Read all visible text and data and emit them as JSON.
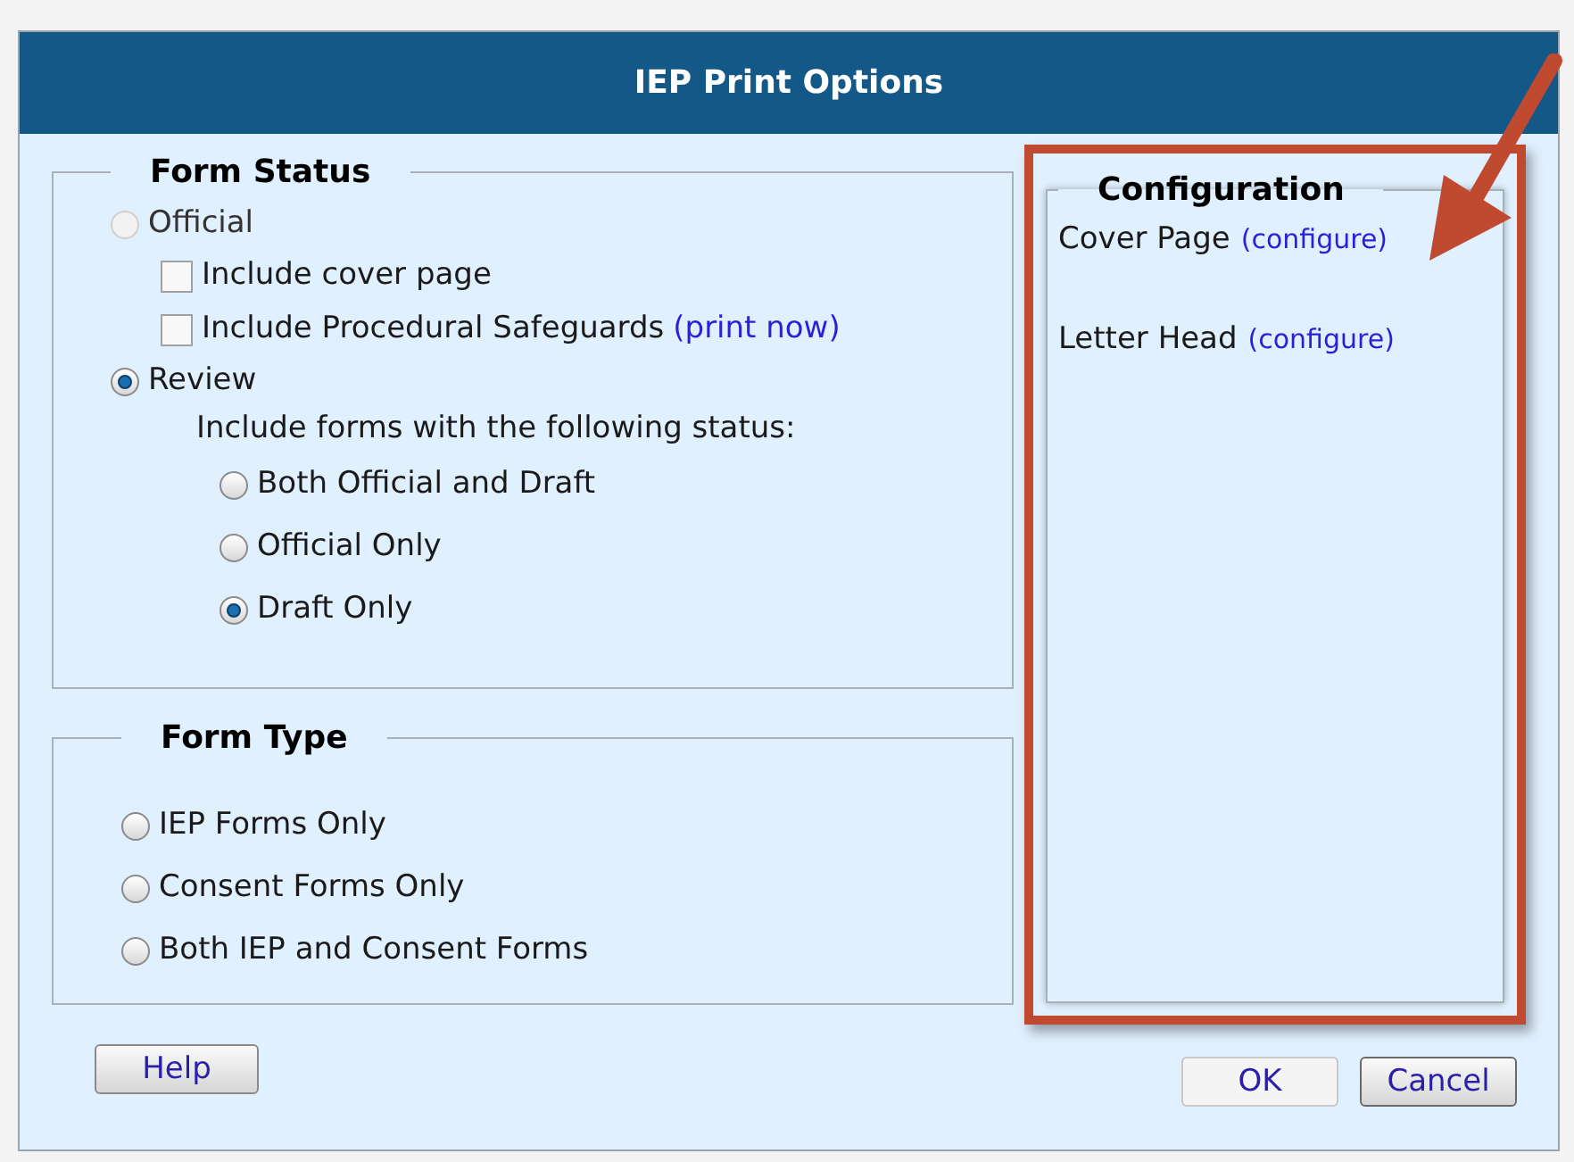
{
  "window": {
    "title": "IEP Print Options"
  },
  "form_status": {
    "legend": "Form Status",
    "official": {
      "label": "Official",
      "selected": false,
      "disabled": true
    },
    "checkboxes": [
      {
        "label": "Include cover page",
        "checked": false
      },
      {
        "label": "Include Procedural Safeguards",
        "checked": false,
        "link": "(print now)"
      }
    ],
    "review": {
      "label": "Review",
      "selected": true
    },
    "hint": "Include forms with the following status:",
    "statuses": [
      {
        "label": "Both Official and Draft",
        "selected": false
      },
      {
        "label": "Official Only",
        "selected": false
      },
      {
        "label": "Draft Only",
        "selected": true
      }
    ]
  },
  "form_type": {
    "legend": "Form Type",
    "options": [
      {
        "label": "IEP Forms Only",
        "selected": false
      },
      {
        "label": "Consent Forms Only",
        "selected": false
      },
      {
        "label": "Both IEP and Consent Forms",
        "selected": false
      }
    ]
  },
  "configuration": {
    "legend": "Configuration",
    "items": [
      {
        "label": "Cover Page",
        "link": "(configure)"
      },
      {
        "label": "Letter Head",
        "link": "(configure)"
      }
    ]
  },
  "buttons": [
    {
      "label": "Help",
      "kind": "secondary"
    },
    {
      "label": "OK",
      "kind": "primary"
    },
    {
      "label": "Cancel",
      "kind": "focused"
    }
  ]
}
